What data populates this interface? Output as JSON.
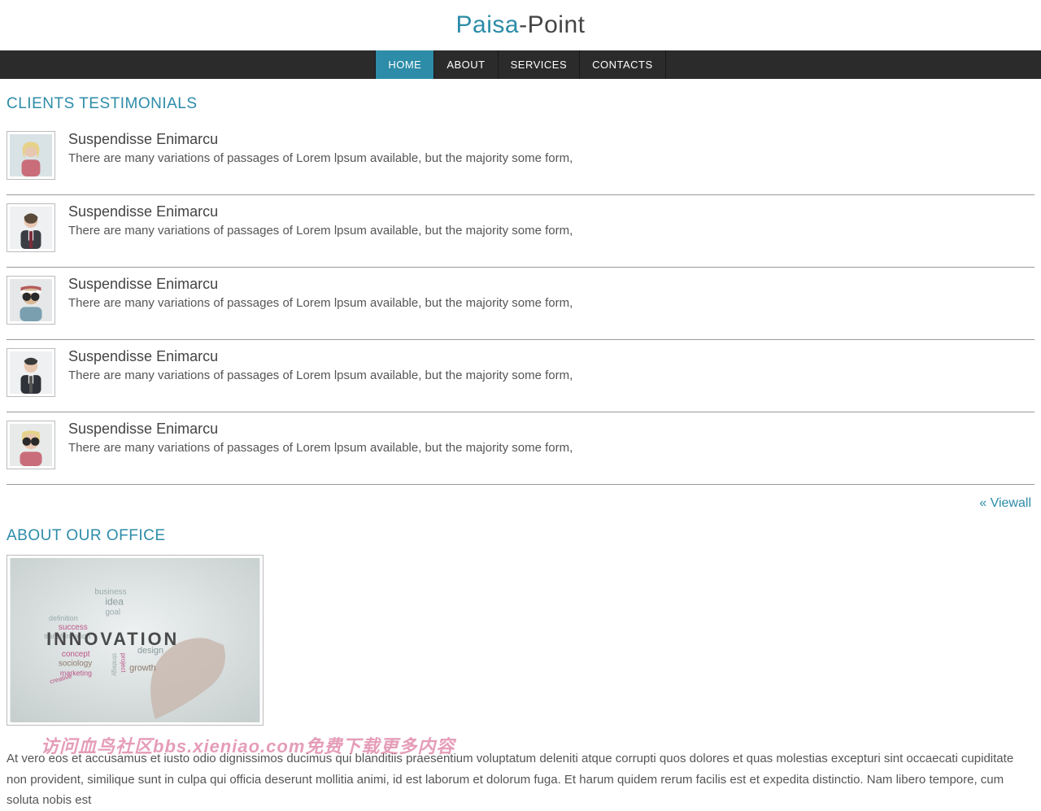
{
  "logo": {
    "part1": "Paisa",
    "sep": "-",
    "part2": "Point"
  },
  "nav": {
    "items": [
      {
        "label": "HOME"
      },
      {
        "label": "ABOUT"
      },
      {
        "label": "SERVICES"
      },
      {
        "label": "CONTACTS"
      }
    ]
  },
  "testimonials": {
    "heading": "CLIENTS TESTIMONIALS",
    "items": [
      {
        "name": "Suspendisse Enimarcu",
        "text": "There are many variations of passages of Lorem lpsum available, but the majority some form,"
      },
      {
        "name": "Suspendisse Enimarcu",
        "text": "There are many variations of passages of Lorem lpsum available, but the majority some form,"
      },
      {
        "name": "Suspendisse Enimarcu",
        "text": "There are many variations of passages of Lorem lpsum available, but the majority some form,"
      },
      {
        "name": "Suspendisse Enimarcu",
        "text": "There are many variations of passages of Lorem lpsum available, but the majority some form,"
      },
      {
        "name": "Suspendisse Enimarcu",
        "text": "There are many variations of passages of Lorem lpsum available, but the majority some form,"
      }
    ],
    "viewall": "« Viewall"
  },
  "office": {
    "heading": "ABOUT OUR OFFICE",
    "image_words": {
      "main": "INNOVATION",
      "minor": [
        "idea",
        "goal",
        "business",
        "definition",
        "success",
        "transformation",
        "concept",
        "sociology",
        "marketing",
        "strategy",
        "project",
        "creative",
        "design",
        "growth"
      ]
    },
    "text": "At vero eos et accusamus et iusto odio dignissimos ducimus qui blanditiis praesentium voluptatum deleniti atque corrupti quos dolores et quas molestias excepturi sint occaecati cupiditate non provident, similique sunt in culpa qui officia deserunt mollitia animi, id est laborum et dolorum fuga. Et harum quidem rerum facilis est et expedita distinctio. Nam libero tempore, cum soluta nobis est"
  },
  "watermark": "访问血鸟社区bbs.xieniao.com免费下载更多内容"
}
